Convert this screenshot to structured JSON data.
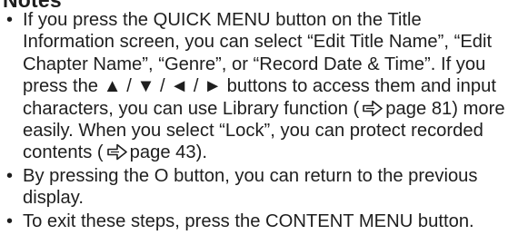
{
  "heading": "Notes",
  "bullet_char": "•",
  "notes": [
    {
      "lines": [
        "If you press the QUICK MENU button on the Title",
        "Information screen, you can select “Edit Title Name”, “Edit",
        "Chapter Name”, “Genre”, or “Record Date & Time”. If you",
        "press the ▲ / ▼ / ◄ / ► buttons to access them and input",
        "characters, you can use Library function (",
        "page 81) more",
        "easily. When you select “Lock”, you can protect recorded",
        "contents (",
        "page 43)."
      ]
    },
    {
      "lines": [
        "By pressing the O button, you can return to the previous",
        "display."
      ]
    },
    {
      "lines": [
        "To exit these steps, press the CONTENT MENU button."
      ]
    }
  ],
  "icons": {
    "page_reference": "page-reference-arrow-icon"
  },
  "colors": {
    "text": "#1e1e1e",
    "icon": "#1e1e1e"
  }
}
